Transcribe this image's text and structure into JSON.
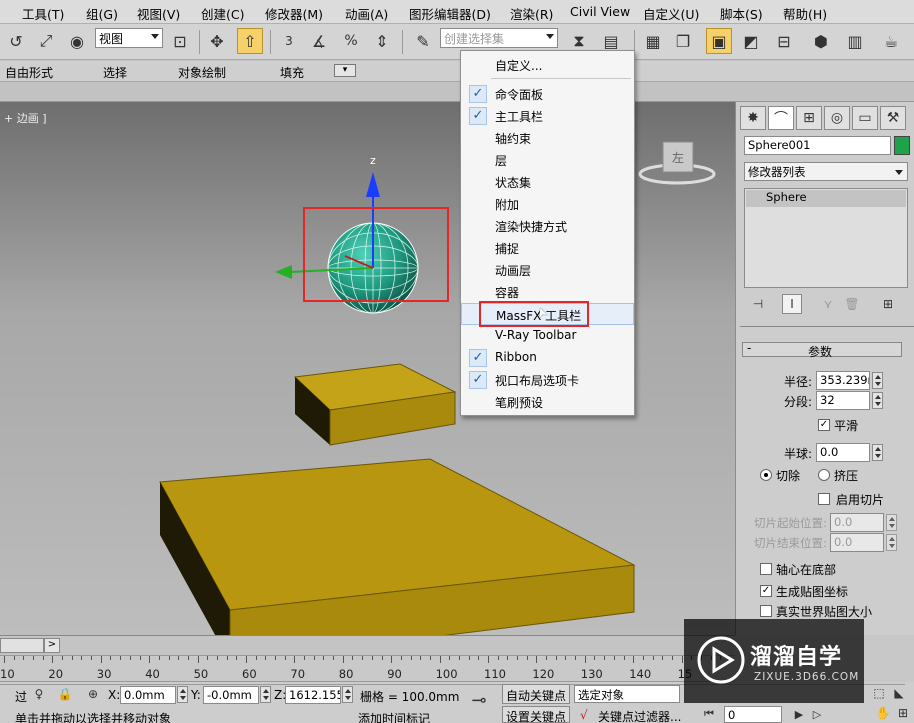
{
  "menubar": {
    "items": [
      "工具(T)",
      "组(G)",
      "视图(V)",
      "创建(C)",
      "修改器(M)",
      "动画(A)",
      "图形编辑器(D)",
      "渲染(R)",
      "Civil View",
      "自定义(U)",
      "脚本(S)",
      "帮助(H)"
    ]
  },
  "toolbar": {
    "view_combo": "视图",
    "selection_set_placeholder": "创建选择集",
    "snap_value": "3",
    "percent_symbol": "%"
  },
  "ribbon": {
    "tabs": [
      "自由形式",
      "选择",
      "对象绘制",
      "填充"
    ]
  },
  "viewport": {
    "label": "+ 边画 ]",
    "axis_z": "z",
    "viewcube_face": "左"
  },
  "context_menu": {
    "items": [
      {
        "label": "自定义...",
        "checked": false
      },
      {
        "label": "命令面板",
        "checked": true
      },
      {
        "label": "主工具栏",
        "checked": true
      },
      {
        "label": "轴约束",
        "checked": false
      },
      {
        "label": "层",
        "checked": false
      },
      {
        "label": "状态集",
        "checked": false
      },
      {
        "label": "附加",
        "checked": false
      },
      {
        "label": "渲染快捷方式",
        "checked": false
      },
      {
        "label": "捕捉",
        "checked": false
      },
      {
        "label": "动画层",
        "checked": false
      },
      {
        "label": "容器",
        "checked": false
      },
      {
        "label": "MassFX 工具栏",
        "checked": false
      },
      {
        "label": "V-Ray Toolbar",
        "checked": false
      },
      {
        "label": "Ribbon",
        "checked": true
      },
      {
        "label": "视口布局选项卡",
        "checked": true
      },
      {
        "label": "笔刷预设",
        "checked": false
      }
    ],
    "check_glyph": "✓"
  },
  "command_panel": {
    "object_name": "Sphere001",
    "object_color": "#1fa34a",
    "modifier_list": "修改器列表",
    "stack_item": "Sphere",
    "rollout_title": "参数",
    "radius_label": "半径:",
    "radius_value": "353.239m",
    "segments_label": "分段:",
    "segments_value": "32",
    "smooth_label": "平滑",
    "hemisphere_label": "半球:",
    "hemisphere_value": "0.0",
    "chop_label": "切除",
    "squash_label": "挤压",
    "slice_on_label": "启用切片",
    "slice_from_label": "切片起始位置:",
    "slice_from_value": "0.0",
    "slice_to_label": "切片结束位置:",
    "slice_to_value": "0.0",
    "base_pivot_label": "轴心在底部",
    "gen_mapping_label": "生成贴图坐标",
    "real_world_label": "真实世界贴图大小"
  },
  "timeline": {
    "arrow": ">",
    "ticks": [
      "10",
      "20",
      "30",
      "40",
      "50",
      "60",
      "70",
      "80",
      "90",
      "100",
      "110",
      "120",
      "130",
      "140",
      "15"
    ]
  },
  "status": {
    "x_label": "X:",
    "x_value": "0.0mm",
    "y_label": "Y:",
    "y_value": "-0.0mm",
    "z_label": "Z:",
    "z_value": "1612.155m",
    "grid_label": "栅格 = 100.0mm",
    "auto_key": "自动关键点",
    "set_key": "设置关键点",
    "selected_object": "选定对象",
    "key_filter": "关键点过滤器...",
    "prompt": "单击并拖动以选择并移动对象",
    "add_time_tag": "添加时间标记",
    "frame_value": "0",
    "left_cut": "过"
  },
  "watermark": {
    "brand": "溜溜自学",
    "url": "ZIXUE.3D66.COM"
  }
}
